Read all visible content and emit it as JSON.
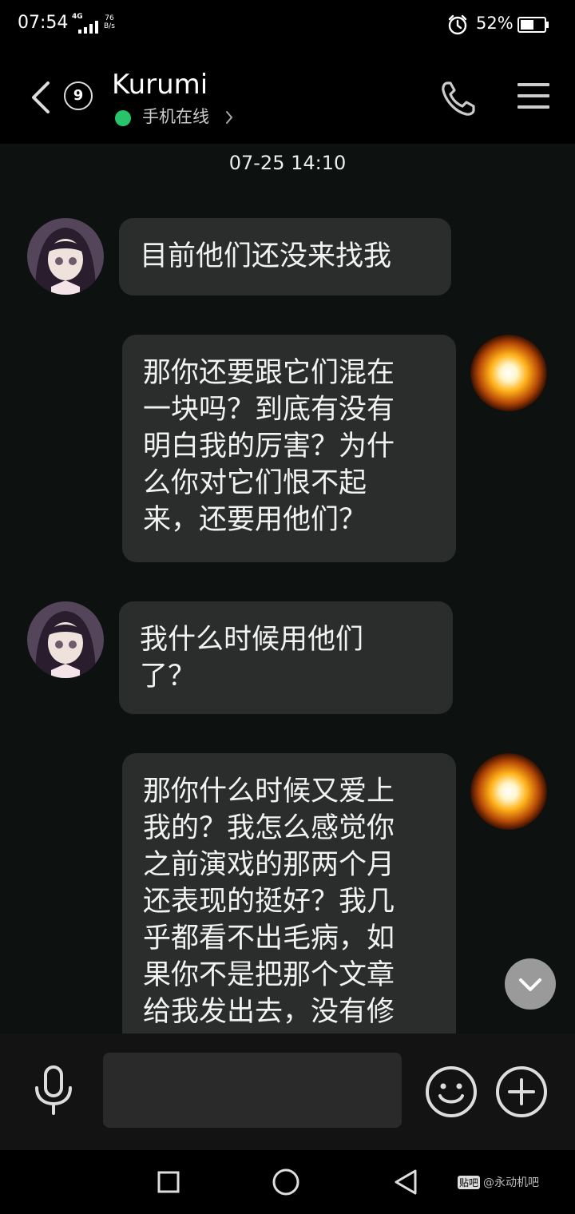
{
  "status_bar": {
    "time": "07:54",
    "network_type": "4G",
    "net_speed_value": "76",
    "net_speed_unit": "B/s",
    "battery_percent": "52%"
  },
  "header": {
    "unread_count": "9",
    "contact_name": "Kurumi",
    "online_status": "手机在线",
    "online_dot_color": "#27c46b"
  },
  "chat": {
    "timestamp": "07-25 14:10",
    "messages": [
      {
        "sender": "contact",
        "text": "目前他们还没来找我"
      },
      {
        "sender": "self",
        "text": "那你还要跟它们混在\n一块吗？到底有没有\n明白我的厉害？为什\n么你对它们恨不起\n来，还要用他们？"
      },
      {
        "sender": "contact",
        "text": "我什么时候用他们\n了？"
      },
      {
        "sender": "self",
        "text": "那你什么时候又爱上\n我的？我怎么感觉你\n之前演戏的那两个月\n还表现的挺好？我几\n乎都看不出毛病，如\n果你不是把那个文章\n给我发出去，没有修\n改，我几乎看不出你"
      }
    ]
  },
  "input_bar": {
    "placeholder": ""
  },
  "watermark": {
    "logo_text": "贴吧",
    "text": "@永动机吧"
  },
  "colors": {
    "background": "#0d1110",
    "bubble": "#2b2d2d",
    "header": "#000000"
  }
}
